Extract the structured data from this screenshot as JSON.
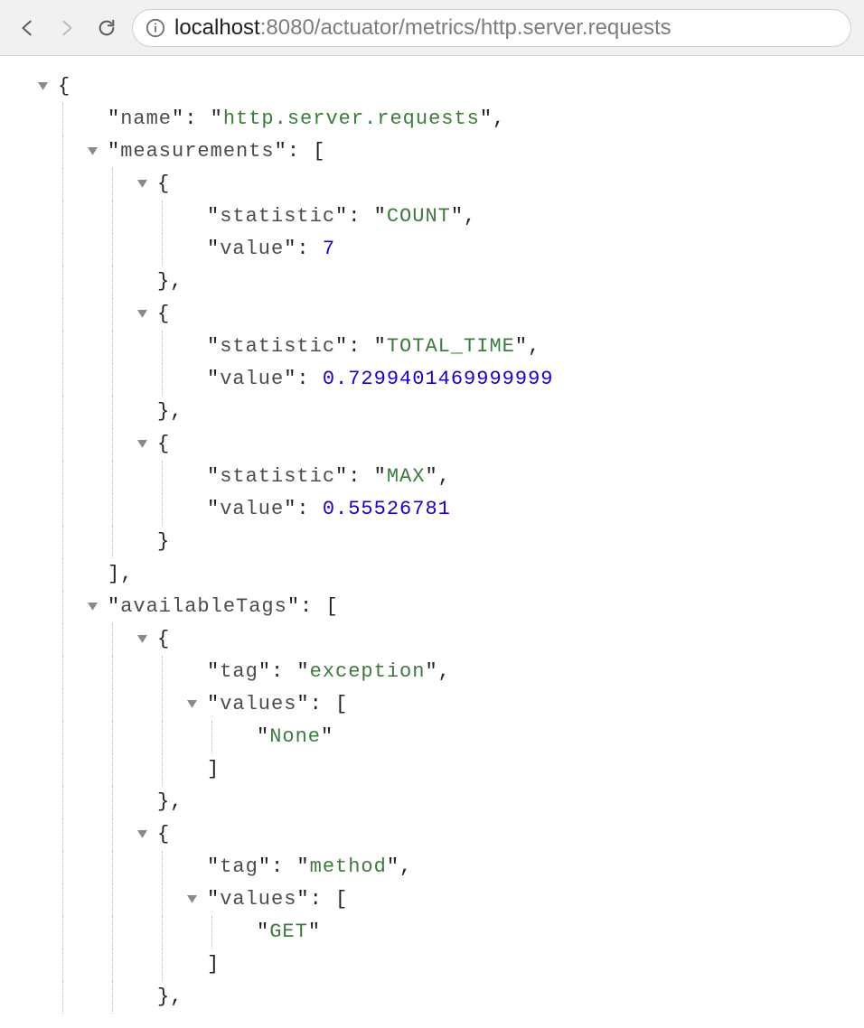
{
  "url": {
    "host": "localhost",
    "port_path": ":8080/actuator/metrics/http.server.requests"
  },
  "json": {
    "keys": {
      "name": "name",
      "measurements": "measurements",
      "statistic": "statistic",
      "value": "value",
      "availableTags": "availableTags",
      "tag": "tag",
      "values": "values"
    },
    "name": "http.server.requests",
    "measurements": [
      {
        "statistic": "COUNT",
        "value": "7"
      },
      {
        "statistic": "TOTAL_TIME",
        "value": "0.7299401469999999"
      },
      {
        "statistic": "MAX",
        "value": "0.55526781"
      }
    ],
    "availableTags": [
      {
        "tag": "exception",
        "values": [
          "None"
        ]
      },
      {
        "tag": "method",
        "values": [
          "GET"
        ]
      }
    ]
  }
}
